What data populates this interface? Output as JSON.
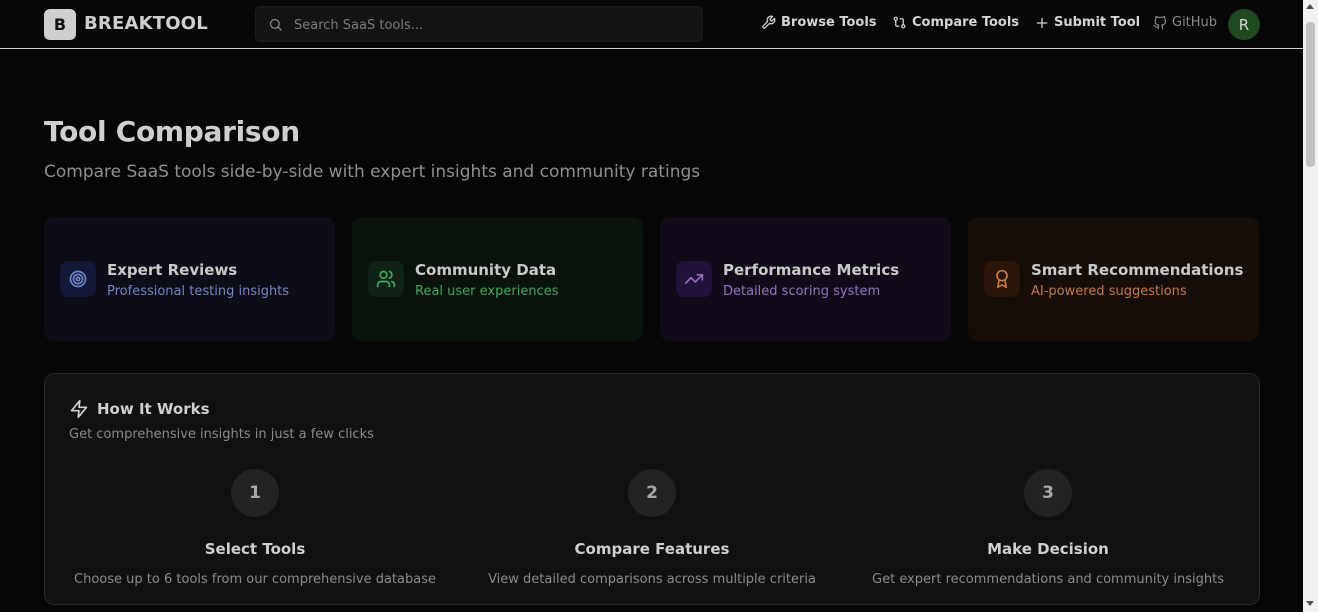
{
  "header": {
    "logo_letter": "B",
    "brand": "BREAKTOOL",
    "search_placeholder": "Search SaaS tools...",
    "nav": {
      "browse": "Browse Tools",
      "compare": "Compare Tools",
      "submit": "Submit Tool",
      "github": "GitHub"
    },
    "avatar_initial": "R"
  },
  "hero": {
    "title": "Tool Comparison",
    "subtitle": "Compare SaaS tools side-by-side with expert insights and community ratings"
  },
  "features": [
    {
      "title": "Expert Reviews",
      "subtitle": "Professional testing insights",
      "icon": "target-icon",
      "color": "#6f86c9"
    },
    {
      "title": "Community Data",
      "subtitle": "Real user experiences",
      "icon": "users-icon",
      "color": "#3fa85c"
    },
    {
      "title": "Performance Metrics",
      "subtitle": "Detailed scoring system",
      "icon": "trending-up-icon",
      "color": "#9570c2"
    },
    {
      "title": "Smart Recommendations",
      "subtitle": "AI-powered suggestions",
      "icon": "award-icon",
      "color": "#c87a3e"
    }
  ],
  "how_it_works": {
    "title": "How It Works",
    "subtitle": "Get comprehensive insights in just a few clicks",
    "steps": [
      {
        "number": "1",
        "title": "Select Tools",
        "description": "Choose up to 6 tools from our comprehensive database"
      },
      {
        "number": "2",
        "title": "Compare Features",
        "description": "View detailed comparisons across multiple criteria"
      },
      {
        "number": "3",
        "title": "Make Decision",
        "description": "Get expert recommendations and community insights"
      }
    ]
  }
}
